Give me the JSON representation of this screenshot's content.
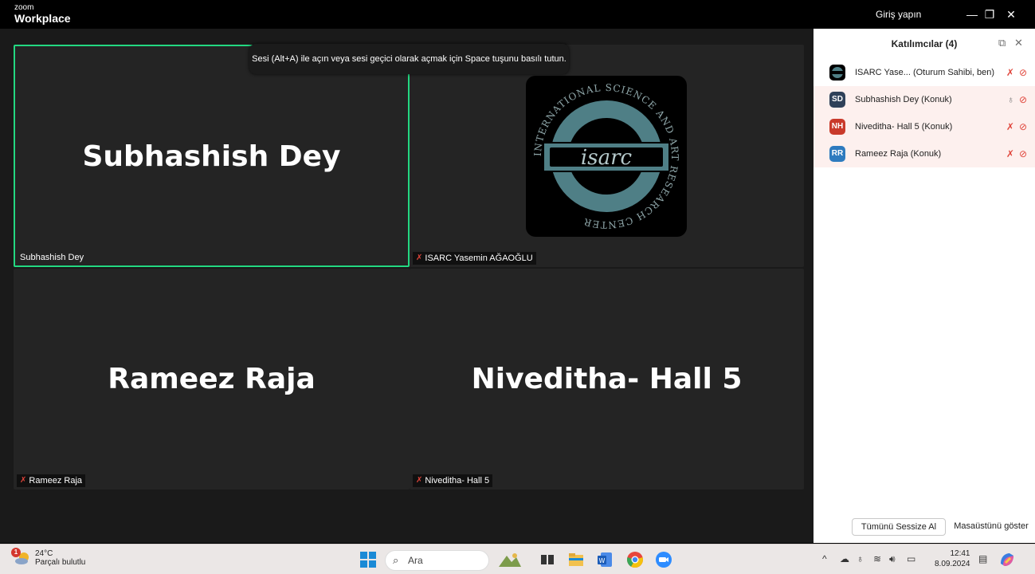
{
  "window": {
    "brand_small": "zoom",
    "brand_big": "Workplace",
    "signin": "Giriş yapın",
    "minimize": "—",
    "restore": "❐",
    "close": "✕"
  },
  "toast": "Sesi (Alt+A) ile açın veya sesi geçici olarak açmak için Space tuşunu basılı tutun.",
  "tiles": {
    "t1": {
      "big_name": "Subhashish Dey",
      "label": "Subhashish Dey"
    },
    "t2": {
      "label": "ISARC Yasemin AĞAOĞLU",
      "logo_text": "isarc",
      "logo_ring": "INTERNATIONAL SCIENCE AND ART RESEARCH CENTER"
    },
    "t3": {
      "big_name": "Rameez Raja",
      "label": "Rameez Raja"
    },
    "t4": {
      "big_name": "Niveditha- Hall 5",
      "label": "Niveditha- Hall 5"
    }
  },
  "panel": {
    "title": "Katılımcılar (4)",
    "participants": [
      {
        "initials": "",
        "name": "ISARC Yase...   (Oturum Sahibi, ben)",
        "color": "#111111"
      },
      {
        "initials": "SD",
        "name": "Subhashish Dey (Konuk)",
        "color": "#2f4159"
      },
      {
        "initials": "NH",
        "name": "Niveditha- Hall 5 (Konuk)",
        "color": "#c93a2b"
      },
      {
        "initials": "RR",
        "name": "Rameez Raja (Konuk)",
        "color": "#2e7bbf"
      }
    ],
    "mute_all": "Tümünü Sessize Al",
    "show_desktop": "Masaüstünü göster"
  },
  "taskbar": {
    "weather_badge": "1",
    "temperature": "24°C",
    "condition": "Parçalı bulutlu",
    "search_placeholder": "Ara",
    "time": "12:41",
    "date": "8.09.2024"
  },
  "colors": {
    "active_speaker": "#23d881",
    "tile_bg": "#242424",
    "muted_red": "#e0443a",
    "guest_row": "#fdf0ee"
  }
}
